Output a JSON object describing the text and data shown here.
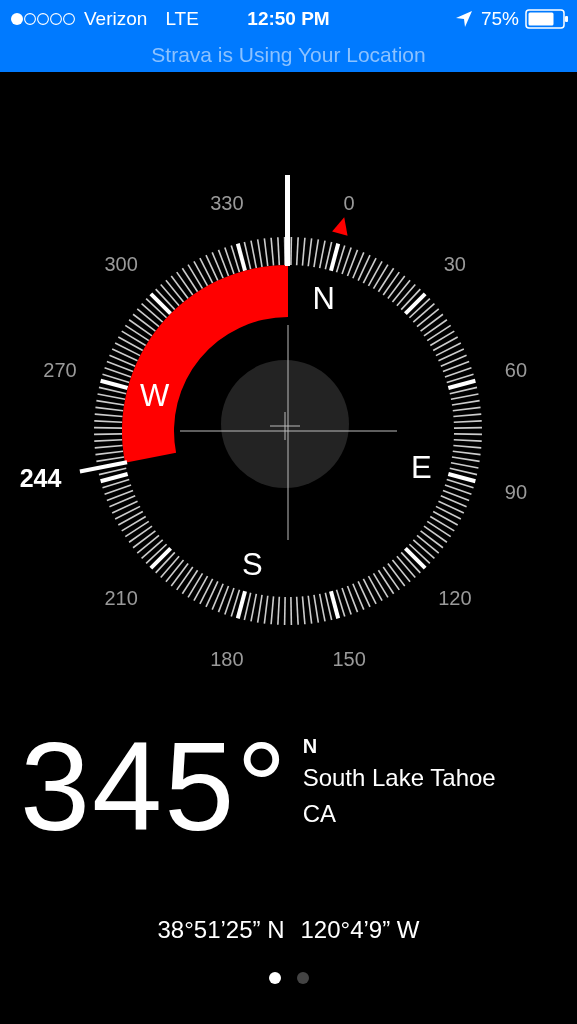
{
  "status_bar": {
    "carrier": "Verizon",
    "network": "LTE",
    "time": "12:50 PM",
    "battery": "75%",
    "banner": "Strava is Using Your Location"
  },
  "compass": {
    "dial_labels": [
      "0",
      "30",
      "60",
      "90",
      "120",
      "150",
      "180",
      "210",
      "270",
      "300",
      "330"
    ],
    "cardinals": [
      "N",
      "E",
      "S",
      "W"
    ],
    "bearing_marker": "244"
  },
  "reading": {
    "heading": "345°",
    "direction": "N",
    "city": "South Lake Tahoe",
    "region": "CA"
  },
  "coordinates": [
    "38°51’25” N",
    "120°4’9” W"
  ],
  "pages": [
    {
      "selected": true
    },
    {
      "selected": false
    }
  ]
}
